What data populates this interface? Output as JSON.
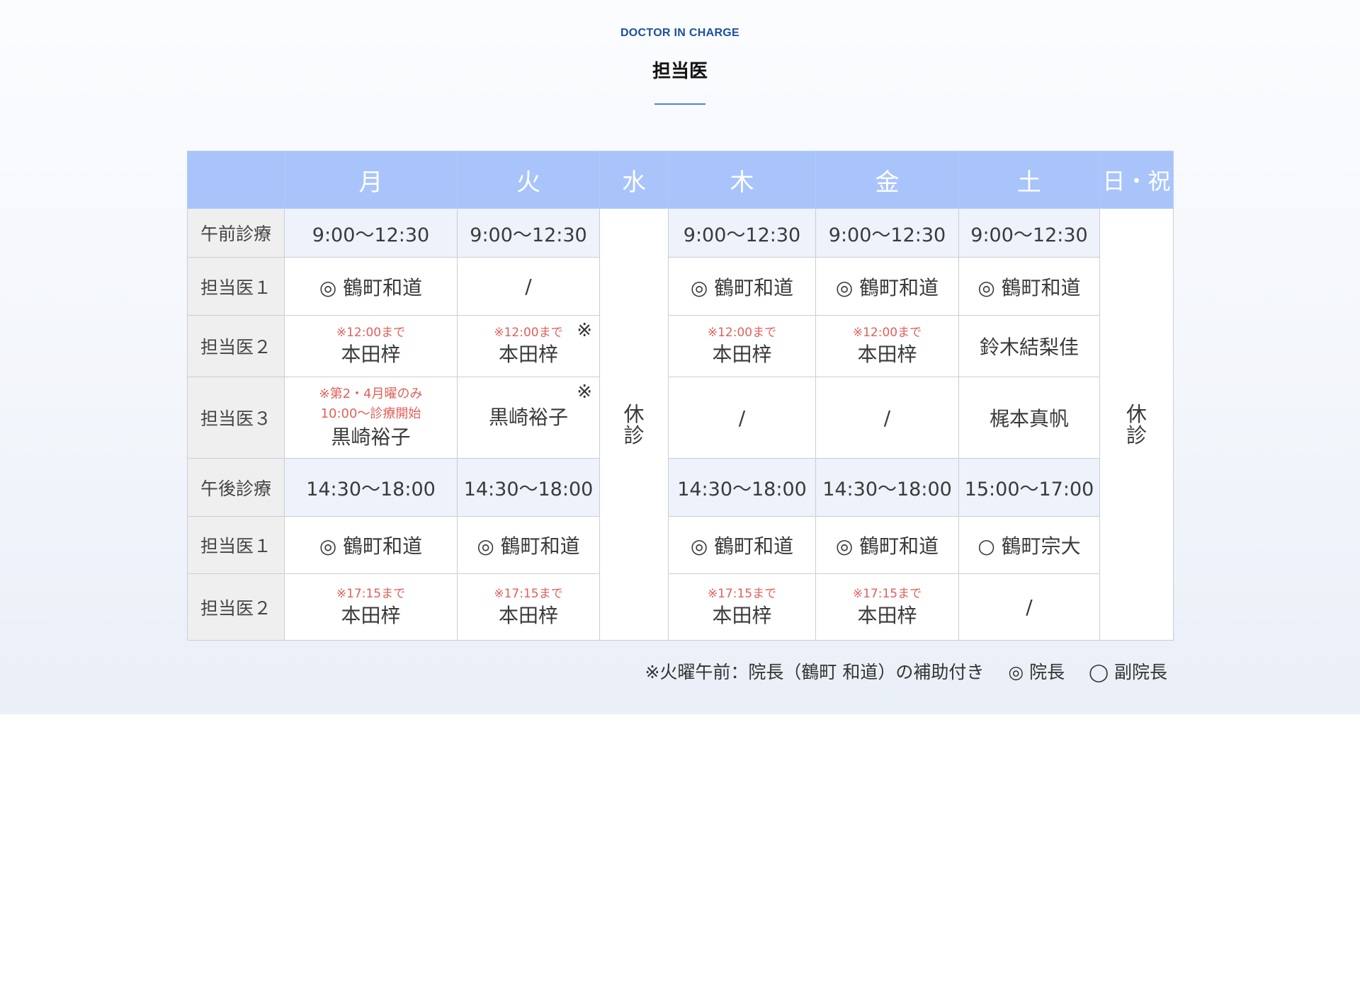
{
  "header": {
    "eyebrow": "DOCTOR IN CHARGE",
    "title": "担当医"
  },
  "days": [
    "月",
    "火",
    "水",
    "木",
    "金",
    "土",
    "日・祝"
  ],
  "closed_label": "休\n診",
  "rows": {
    "am_label": "午前診療",
    "pm_label": "午後診療",
    "doc1_label": "担当医１",
    "doc2_label": "担当医２",
    "doc3_label": "担当医３"
  },
  "am": {
    "times": {
      "mon": "9:00〜12:30",
      "tue": "9:00〜12:30",
      "thu": "9:00〜12:30",
      "fri": "9:00〜12:30",
      "sat": "9:00〜12:30"
    },
    "doc1": {
      "mon": "◎ 鶴町和道",
      "tue": "/",
      "thu": "◎ 鶴町和道",
      "fri": "◎ 鶴町和道",
      "sat": "◎ 鶴町和道"
    },
    "doc2": {
      "mon_note": "※12:00まで",
      "mon": "本田梓",
      "tue_note": "※12:00まで",
      "tue": "本田梓",
      "tue_mark": "※",
      "thu_note": "※12:00まで",
      "thu": "本田梓",
      "fri_note": "※12:00まで",
      "fri": "本田梓",
      "sat": "鈴木結梨佳"
    },
    "doc3": {
      "mon_note1": "※第2・4月曜のみ",
      "mon_note2": "10:00〜診療開始",
      "mon": "黒崎裕子",
      "tue": "黒崎裕子",
      "tue_mark": "※",
      "thu": "/",
      "fri": "/",
      "sat": "梶本真帆"
    }
  },
  "pm": {
    "times": {
      "mon": "14:30〜18:00",
      "tue": "14:30〜18:00",
      "thu": "14:30〜18:00",
      "fri": "14:30〜18:00",
      "sat": "15:00〜17:00"
    },
    "doc1": {
      "mon": "◎ 鶴町和道",
      "tue": "◎ 鶴町和道",
      "thu": "◎ 鶴町和道",
      "fri": "◎ 鶴町和道",
      "sat": "○ 鶴町宗大"
    },
    "doc2": {
      "mon_note": "※17:15まで",
      "mon": "本田梓",
      "tue_note": "※17:15まで",
      "tue": "本田梓",
      "thu_note": "※17:15まで",
      "thu": "本田梓",
      "fri_note": "※17:15まで",
      "fri": "本田梓",
      "sat": "/"
    }
  },
  "footnote": {
    "note": "※火曜午前：院長（鶴町 和道）の補助付き",
    "legend_director": "◎ 院長",
    "legend_vice": "◯ 副院長"
  }
}
